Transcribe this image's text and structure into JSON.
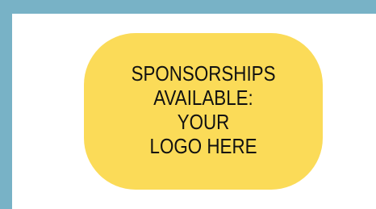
{
  "colors": {
    "background": "#78b2c6",
    "panel": "#ffffff",
    "badge": "#fbdb58",
    "text": "#111111"
  },
  "sponsor_badge": {
    "lines": [
      "SPONSORSHIPS",
      "AVAILABLE:",
      "YOUR",
      "LOGO HERE"
    ]
  }
}
